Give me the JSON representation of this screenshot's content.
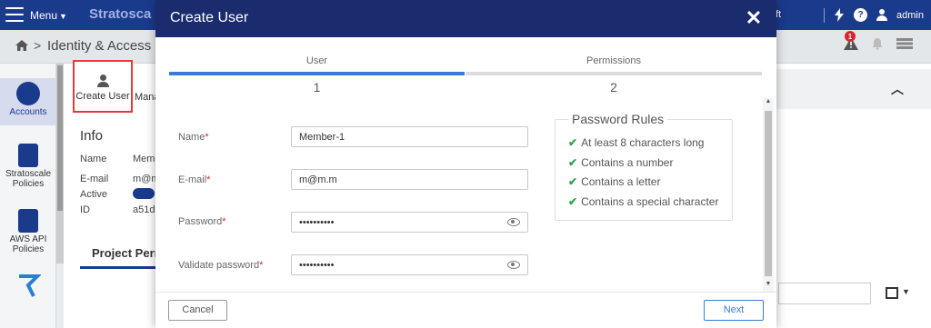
{
  "app": {
    "menu_label": "Menu",
    "brand": "Stratosca",
    "top_right_fragment": "ft",
    "help_symbol": "?",
    "username": "admin"
  },
  "breadcrumb": {
    "arrow": ">",
    "section": "Identity & Access",
    "alert_count": "1"
  },
  "left_nav": {
    "items": [
      {
        "label": "Accounts"
      },
      {
        "label": "Stratoscale Policies"
      },
      {
        "label": "AWS API Policies"
      }
    ]
  },
  "toolbar": {
    "create_user_label": "Create User",
    "manage_fragment": "Mana"
  },
  "info_panel": {
    "title": "Info",
    "rows": [
      {
        "label": "Name",
        "value": "Memb"
      },
      {
        "label": "E-mail",
        "value": "m@m"
      },
      {
        "label": "Active",
        "value": ""
      },
      {
        "label": "ID",
        "value": "a51d"
      }
    ]
  },
  "tabs": {
    "project_permissions_fragment": "Project Perm"
  },
  "modal": {
    "title": "Create User",
    "close_symbol": "✕",
    "steps": [
      {
        "label": "User",
        "number": "1",
        "active": true
      },
      {
        "label": "Permissions",
        "number": "2",
        "active": false
      }
    ],
    "fields": [
      {
        "label": "Name",
        "value": "Member-1",
        "required": true
      },
      {
        "label": "E-mail",
        "value": "m@m.m",
        "required": true
      },
      {
        "label": "Password",
        "value": "••••••••••",
        "required": true
      },
      {
        "label": "Validate password",
        "value": "••••••••••",
        "required": true
      }
    ],
    "required_mark": "*",
    "password_rules": {
      "title": "Password Rules",
      "check_symbol": "✔",
      "rules": [
        "At least 8 characters long",
        "Contains a number",
        "Contains a letter",
        "Contains a special character"
      ]
    },
    "footer": {
      "cancel_label": "Cancel",
      "next_label": "Next"
    }
  },
  "colors": {
    "header_navy": "#1a2c6e",
    "topbar_blue": "#1a3a8c",
    "active_step": "#3a7bd5",
    "check_green": "#2ea44f",
    "required_red": "#d9262c",
    "highlight_red": "#e23b3b"
  },
  "icons": [
    "hamburger-icon",
    "chevron-down-icon",
    "bolt-icon",
    "help-icon",
    "user-icon",
    "home-icon",
    "alert-icon",
    "bell-icon",
    "list-icon",
    "chevron-up-icon",
    "grid-icon",
    "eye-icon",
    "check-icon",
    "close-icon"
  ]
}
